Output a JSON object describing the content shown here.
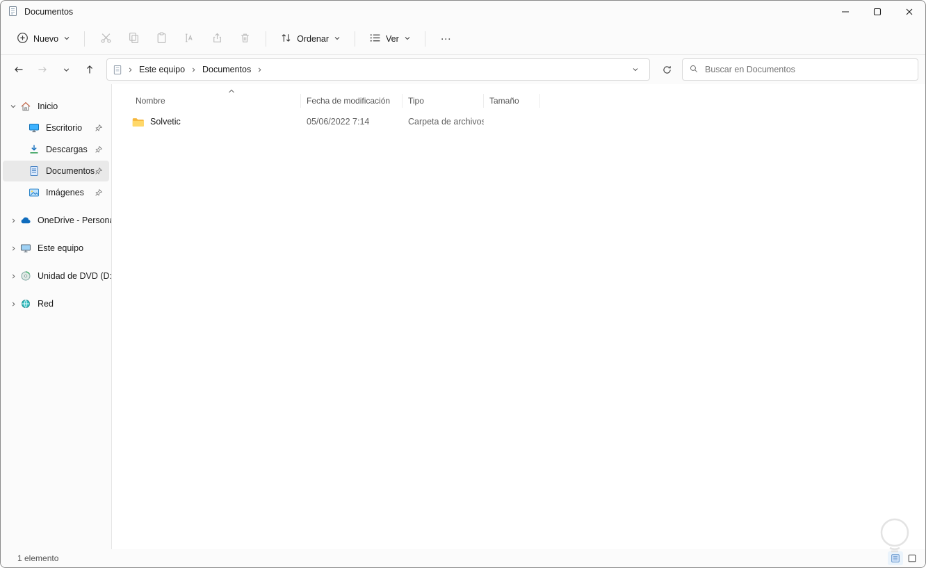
{
  "window": {
    "title": "Documentos"
  },
  "toolbar": {
    "new_label": "Nuevo",
    "sort_label": "Ordenar",
    "view_label": "Ver",
    "more_label": "…"
  },
  "address_bar": {
    "crumbs": [
      "Este equipo",
      "Documentos"
    ],
    "search_placeholder": "Buscar en Documentos"
  },
  "sidebar": {
    "items": [
      {
        "label": "Inicio"
      },
      {
        "label": "Escritorio"
      },
      {
        "label": "Descargas"
      },
      {
        "label": "Documentos"
      },
      {
        "label": "Imágenes"
      },
      {
        "label": "OneDrive - Personal"
      },
      {
        "label": "Este equipo"
      },
      {
        "label": "Unidad de DVD (D:)"
      },
      {
        "label": "Red"
      }
    ]
  },
  "file_list": {
    "columns": [
      "Nombre",
      "Fecha de modificación",
      "Tipo",
      "Tamaño"
    ],
    "rows": [
      {
        "name": "Solvetic",
        "modified": "05/06/2022 7:14",
        "type": "Carpeta de archivos",
        "size": ""
      }
    ]
  },
  "status_bar": {
    "count": "1 elemento"
  }
}
